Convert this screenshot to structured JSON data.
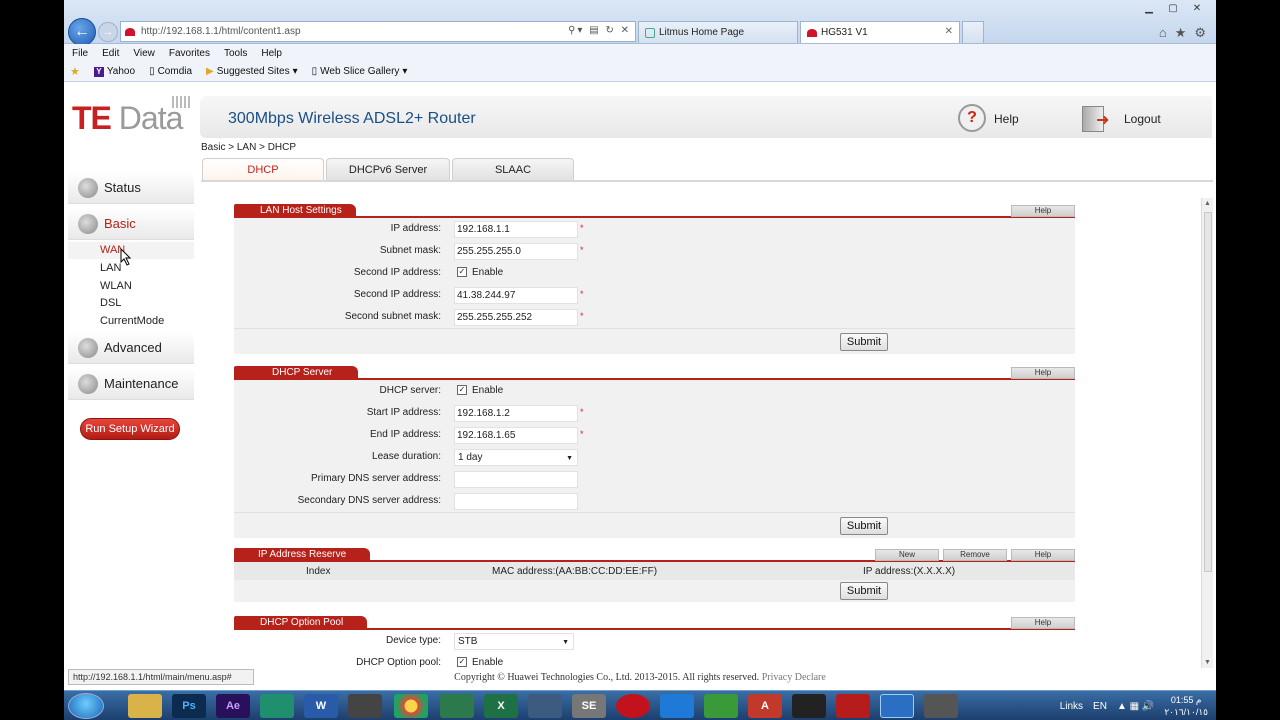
{
  "browser": {
    "address": "http://192.168.1.1/html/content1.asp",
    "tabs": [
      {
        "label": "Litmus Home Page"
      },
      {
        "label": "HG531 V1"
      }
    ],
    "menu": [
      "File",
      "Edit",
      "View",
      "Favorites",
      "Tools",
      "Help"
    ],
    "favorites": [
      "Yahoo",
      "Comdia",
      "Suggested Sites",
      "Web Slice Gallery"
    ],
    "status_url": "http://192.168.1.1/html/main/menu.asp#"
  },
  "header": {
    "logo_te": "TE",
    "logo_data": "Data",
    "title": "300Mbps Wireless ADSL2+ Router",
    "help": "Help",
    "logout": "Logout"
  },
  "sidebar": {
    "items": [
      {
        "label": "Status"
      },
      {
        "label": "Basic"
      },
      {
        "label": "Advanced"
      },
      {
        "label": "Maintenance"
      }
    ],
    "sub": [
      "WAN",
      "LAN",
      "WLAN",
      "DSL",
      "CurrentMode"
    ],
    "wizard": "Run Setup Wizard"
  },
  "breadcrumb": "Basic > LAN > DHCP",
  "page_tabs": [
    "DHCP",
    "DHCPv6 Server",
    "SLAAC"
  ],
  "lan_host": {
    "title": "LAN Host Settings",
    "help": "Help",
    "ip_label": "IP address:",
    "ip_value": "192.168.1.1",
    "mask_label": "Subnet mask:",
    "mask_value": "255.255.255.0",
    "second_enable_label": "Second IP address:",
    "enable": "Enable",
    "second_ip_label": "Second IP address:",
    "second_ip_value": "41.38.244.97",
    "second_mask_label": "Second subnet mask:",
    "second_mask_value": "255.255.255.252",
    "submit": "Submit"
  },
  "dhcp_server": {
    "title": "DHCP Server",
    "help": "Help",
    "server_label": "DHCP server:",
    "enable": "Enable",
    "start_label": "Start IP address:",
    "start_value": "192.168.1.2",
    "end_label": "End IP address:",
    "end_value": "192.168.1.65",
    "lease_label": "Lease duration:",
    "lease_value": "1 day",
    "pdns_label": "Primary DNS server address:",
    "sdns_label": "Secondary DNS server address:",
    "submit": "Submit"
  },
  "ip_reserve": {
    "title": "IP Address Reserve",
    "new": "New",
    "remove": "Remove",
    "help": "Help",
    "col_index": "Index",
    "col_mac": "MAC address:(AA:BB:CC:DD:EE:FF)",
    "col_ip": "IP address:(X.X.X.X)",
    "submit": "Submit"
  },
  "option_pool": {
    "title": "DHCP Option Pool",
    "help": "Help",
    "device_label": "Device type:",
    "device_value": "STB",
    "pool_label": "DHCP Option pool:",
    "enable": "Enable"
  },
  "copyright": "Copyright © Huawei Technologies Co., Ltd. 2013-2015. All rights reserved.",
  "privacy": "Privacy Declare",
  "taskbar": {
    "apps": [
      "Ps",
      "Ae",
      "W",
      "X",
      "SE",
      "A"
    ],
    "links": "Links",
    "lang": "EN",
    "time": "01:55  م",
    "date": "٢٠١٦/١٠/١٥"
  }
}
